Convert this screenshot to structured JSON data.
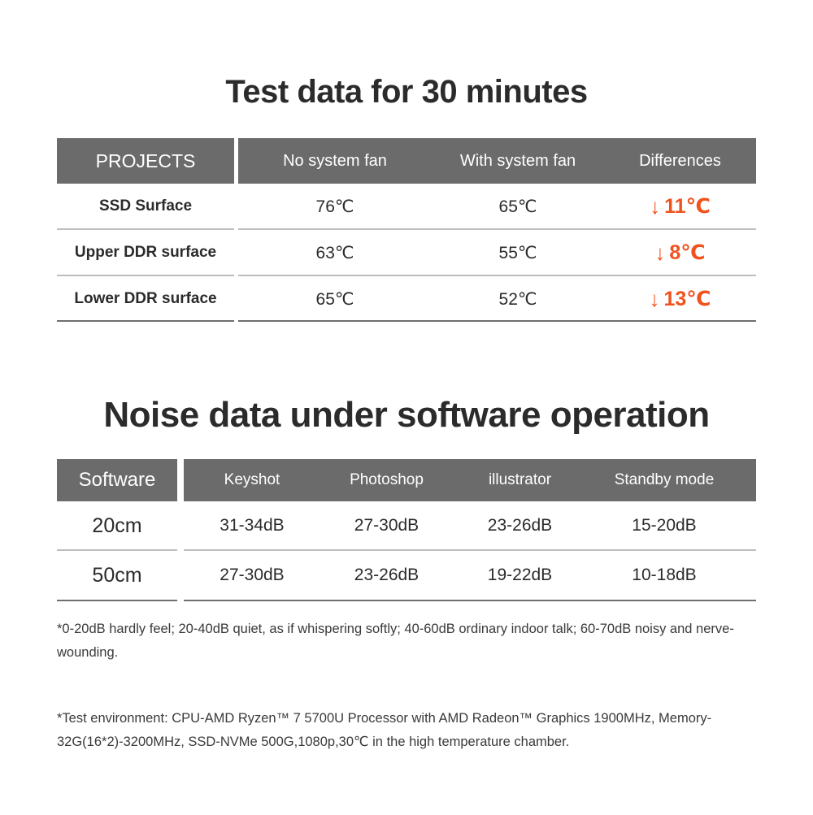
{
  "colors": {
    "header_bg": "#6b6b6b",
    "header_text": "#ffffff",
    "accent_orange": "#f0521e",
    "body_text": "#2b2b2b",
    "divider": "#bdbdbd",
    "bottom_rule": "#6f6f6f",
    "background": "#ffffff"
  },
  "section1": {
    "title": "Test data for 30 minutes",
    "table": {
      "first_column_header": "PROJECTS",
      "headers": [
        "No system fan",
        "With system fan",
        "Differences"
      ],
      "rows": [
        {
          "label": "SSD Surface",
          "no_fan": "76℃",
          "with_fan": "65℃",
          "difference_arrow": "↓",
          "difference_value": "11℃"
        },
        {
          "label": "Upper DDR surface",
          "no_fan": "63℃",
          "with_fan": "55℃",
          "difference_arrow": "↓",
          "difference_value": "8℃"
        },
        {
          "label": "Lower DDR surface",
          "no_fan": "65℃",
          "with_fan": "52℃",
          "difference_arrow": "↓",
          "difference_value": "13℃"
        }
      ]
    }
  },
  "section2": {
    "title": "Noise data under software operation",
    "table": {
      "first_column_header": "Software",
      "headers": [
        "Keyshot",
        "Photoshop",
        "illustrator",
        "Standby mode"
      ],
      "rows": [
        {
          "label": "20cm",
          "values": [
            "31-34dB",
            "27-30dB",
            "23-26dB",
            "15-20dB"
          ]
        },
        {
          "label": "50cm",
          "values": [
            "27-30dB",
            "23-26dB",
            "19-22dB",
            "10-18dB"
          ]
        }
      ]
    }
  },
  "notes": {
    "noise_reference": "*0-20dB hardly feel; 20-40dB quiet, as if whispering softly; 40-60dB ordinary indoor talk; 60-70dB noisy and nerve-wounding.",
    "test_environment": "*Test environment: CPU-AMD Ryzen™ 7 5700U Processor with AMD Radeon™ Graphics 1900MHz, Memory-32G(16*2)-3200MHz, SSD-NVMe 500G,1080p,30℃ in the high temperature chamber."
  }
}
